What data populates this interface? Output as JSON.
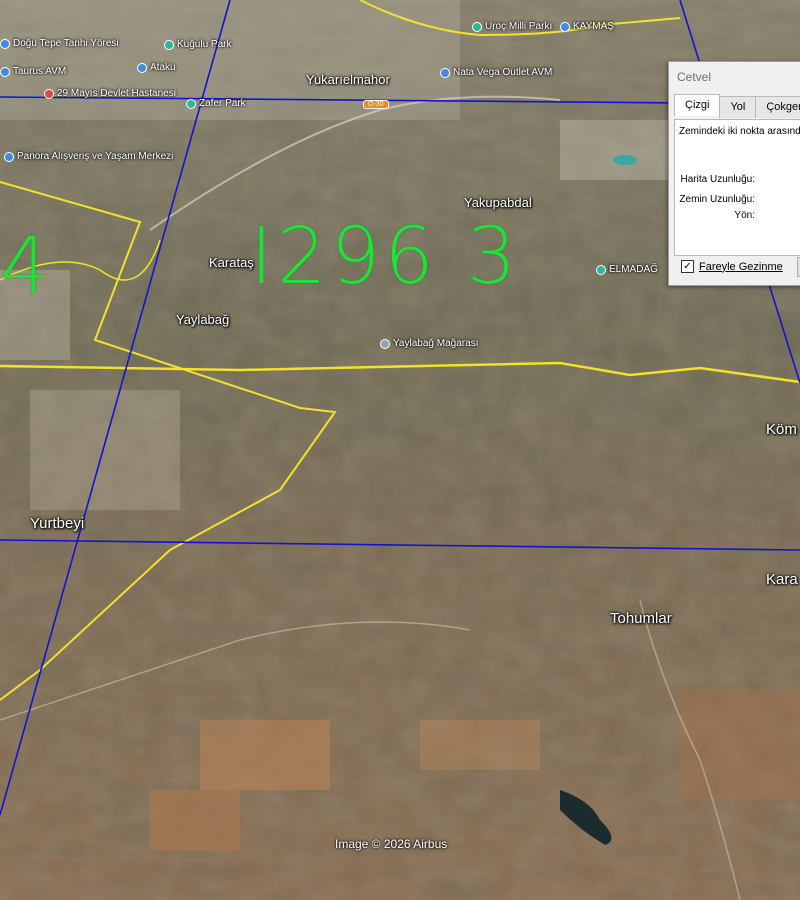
{
  "labels": {
    "large": [
      {
        "id": "karatas",
        "text": "Karataş"
      },
      {
        "id": "yaylabag",
        "text": "Yaylabağ"
      },
      {
        "id": "yakupabdal",
        "text": "Yakupabdal"
      },
      {
        "id": "yurtbeyi",
        "text": "Yurtbeyi"
      },
      {
        "id": "tohumlar",
        "text": "Tohumlar"
      },
      {
        "id": "kom",
        "text": "Köm"
      },
      {
        "id": "kara",
        "text": "Kara"
      },
      {
        "id": "yukarielmahor",
        "text": "Yukarıelmahor"
      }
    ],
    "pois": [
      {
        "id": "kugulu-park",
        "text": "Kuğulu Park",
        "icon": "teal"
      },
      {
        "id": "ataku",
        "text": "Ataku",
        "icon": "blue"
      },
      {
        "id": "taurus-avm",
        "text": "Taurus AVM",
        "icon": "blue"
      },
      {
        "id": "mayis-hastanesi",
        "text": "29 Mayıs Devlet Hastanesi",
        "icon": "red"
      },
      {
        "id": "zafer-park",
        "text": "Zafer Park",
        "icon": "teal"
      },
      {
        "id": "panora",
        "text": "Panora Alışveriş ve Yaşam Merkezi",
        "icon": "blue"
      },
      {
        "id": "nata-vega",
        "text": "Nata Vega Outlet AVM",
        "icon": "blue"
      },
      {
        "id": "uroc",
        "text": "Uroç Milli Parkı",
        "icon": "teal"
      },
      {
        "id": "kaymas",
        "text": "KAYMAŞ",
        "icon": "blue"
      },
      {
        "id": "yaylabag-magarasi",
        "text": "Yaylabağ Mağarası",
        "icon": "grey"
      },
      {
        "id": "elmadag",
        "text": "ELMADAĞ",
        "icon": "teal"
      },
      {
        "id": "dogu-tepe",
        "text": "Doğu Tepe Tarihi Yöresi",
        "icon": "blue"
      }
    ],
    "road_badge": "O-30",
    "handwritten_number": "I296 3",
    "handwritten_left": "4",
    "credit": "Image © 2026 Airbus"
  },
  "ruler": {
    "title": "Cetvel",
    "tabs": [
      "Çizgi",
      "Yol",
      "Çokgen"
    ],
    "active_tab": "Çizgi",
    "description": "Zemindeki iki nokta arasınd",
    "fields": [
      "Harita Uzunluğu:",
      "Zemin Uzunluğu:",
      "Yön:"
    ],
    "mouse_nav_label": "Fareyle Gezinme",
    "mouse_nav_checked": true,
    "check_mark": "✓"
  },
  "colors": {
    "grid_line": "#1414d0",
    "boundary": "#f1e12a",
    "handwriting": "#22e03a"
  }
}
